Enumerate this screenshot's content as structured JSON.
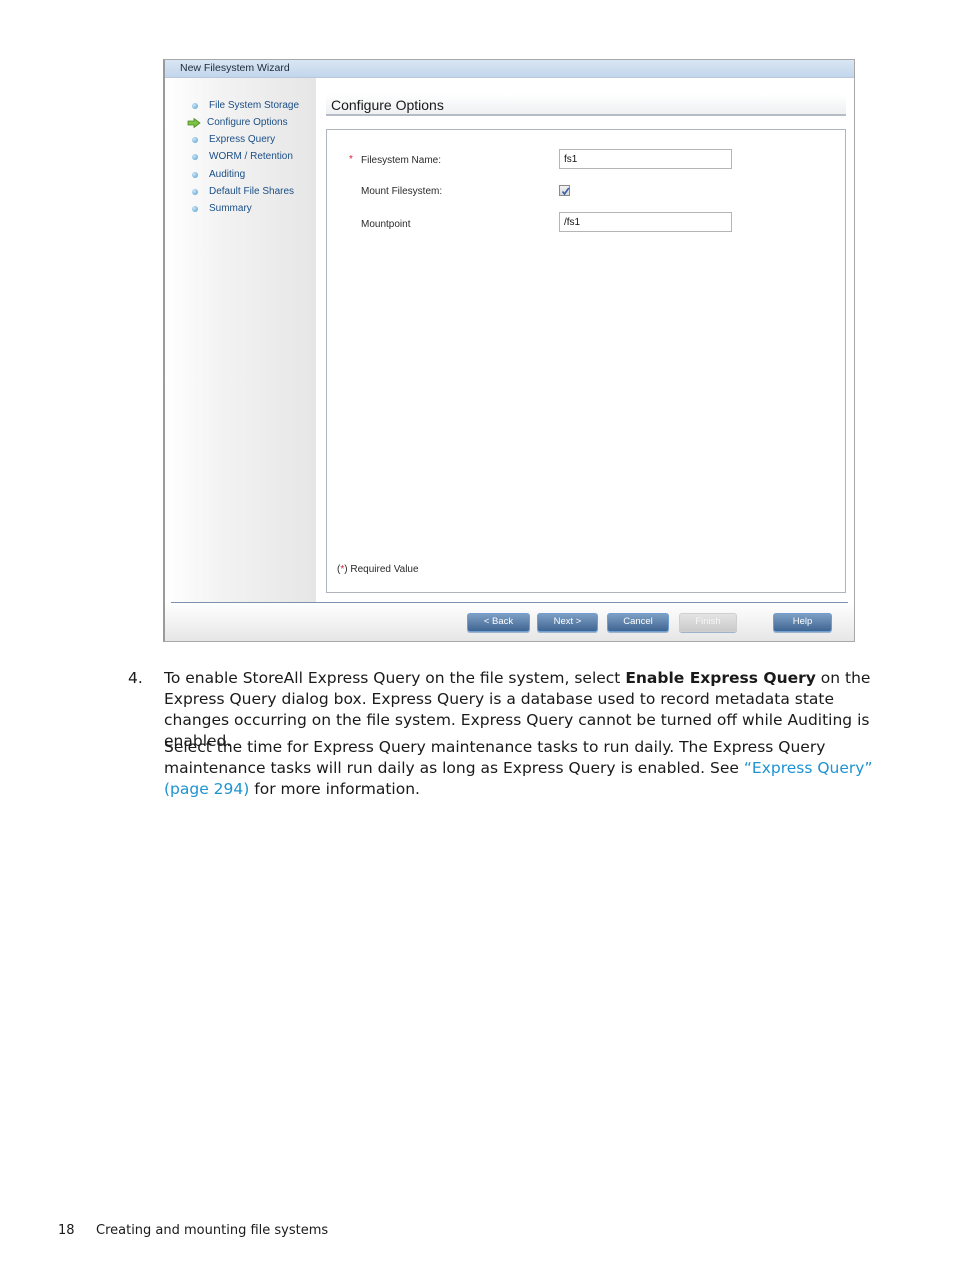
{
  "wizard": {
    "title": "New Filesystem Wizard",
    "nav_items": [
      {
        "label": "File System Storage",
        "icon": "bullet-icon",
        "current": false
      },
      {
        "label": "Configure Options",
        "icon": "arrow-right-icon",
        "current": true
      },
      {
        "label": "Express Query",
        "icon": "bullet-icon",
        "current": false
      },
      {
        "label": "WORM / Retention",
        "icon": "bullet-icon",
        "current": false
      },
      {
        "label": "Auditing",
        "icon": "bullet-icon",
        "current": false
      },
      {
        "label": "Default File Shares",
        "icon": "bullet-icon",
        "current": false
      },
      {
        "label": "Summary",
        "icon": "bullet-icon",
        "current": false
      }
    ],
    "panel_title": "Configure Options",
    "form": {
      "required_marker": "*",
      "filesystem_name_label": "Filesystem Name:",
      "filesystem_name_value": "fs1",
      "mount_filesystem_label": "Mount Filesystem:",
      "mount_filesystem_checked": true,
      "mountpoint_label": "Mountpoint",
      "mountpoint_value": "/fs1",
      "required_note_open": "(",
      "required_note_star": "*",
      "required_note_rest": ") Required Value"
    },
    "buttons": {
      "back": "< Back",
      "next": "Next >",
      "cancel": "Cancel",
      "finish": "Finish",
      "help": "Help"
    },
    "colors": {
      "nav_text": "#1b4f86",
      "required_star": "#d9232e",
      "button_blue": "#3f6592"
    }
  },
  "document": {
    "step_number": "4.",
    "para1_pre": "To enable StoreAll Express Query on the file system, select ",
    "para1_bold": "Enable Express Query",
    "para1_post": " on the Express Query dialog box. Express Query is a database used to record metadata state changes occurring on the file system. Express Query cannot be turned off while Auditing is enabled.",
    "para2_pre": "Select the time for Express Query maintenance tasks to run daily. The Express Query maintenance tasks will run daily as long as Express Query is enabled. See ",
    "para2_link": "“Express Query” (page 294)",
    "para2_post": " for more information.",
    "link_color": "#1d93d2"
  },
  "footer": {
    "page_number": "18",
    "section_title": "Creating and mounting file systems"
  }
}
